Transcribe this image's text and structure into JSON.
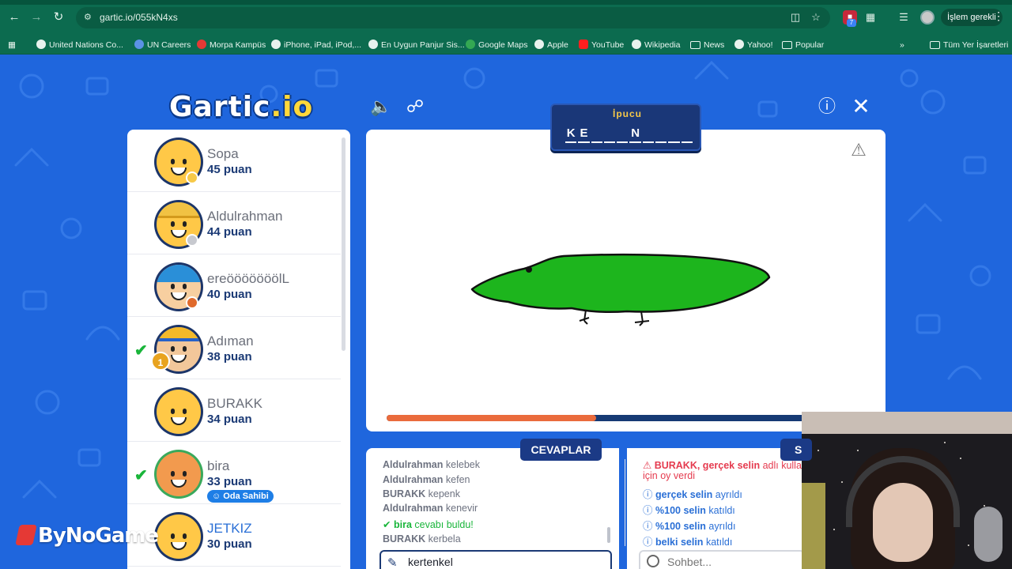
{
  "browser": {
    "url": "gartic.io/055kN4xs",
    "profile_button": "İşlem gerekli",
    "extension_badge": "7",
    "bookmarks": [
      {
        "label": "United Nations Co...",
        "icon": "un-icon"
      },
      {
        "label": "UN Careers",
        "icon": "un-icon"
      },
      {
        "label": "Morpa Kampüs",
        "icon": "morpa-icon"
      },
      {
        "label": "iPhone, iPad, iPod,...",
        "icon": "globe-icon"
      },
      {
        "label": "En Uygun Panjur Sis...",
        "icon": "globe-icon"
      },
      {
        "label": "Google Maps",
        "icon": "maps-icon"
      },
      {
        "label": "Apple",
        "icon": "globe-icon"
      },
      {
        "label": "YouTube",
        "icon": "youtube-icon"
      },
      {
        "label": "Wikipedia",
        "icon": "globe-icon"
      },
      {
        "label": "News",
        "icon": "folder-icon"
      },
      {
        "label": "Yahoo!",
        "icon": "globe-icon"
      },
      {
        "label": "Popular",
        "icon": "folder-icon"
      }
    ],
    "all_bookmarks": "Tüm Yer İşaretleri"
  },
  "game": {
    "logo_main": "Gartic",
    "logo_suffix": ".io",
    "hint_title": "İpucu",
    "hint_letters": [
      "K",
      "E",
      "",
      "",
      "",
      "N",
      "",
      "",
      "",
      "",
      ""
    ],
    "timer_progress": 0.49,
    "players": [
      {
        "name": "Sopa",
        "score": "45 puan",
        "status_color": "#f7c948",
        "hair": "none",
        "checked": false
      },
      {
        "name": "Aldulrahman",
        "score": "44 puan",
        "status_color": "#c7c9cf",
        "hair": "blonde",
        "checked": false
      },
      {
        "name": "ereööööööölL",
        "score": "40 puan",
        "status_color": "#e06a2c",
        "hair": "blue",
        "checked": false
      },
      {
        "name": "Adıman",
        "score": "38 puan",
        "status_color": "",
        "hair": "cap",
        "checked": true,
        "trophy": "1"
      },
      {
        "name": "BURAKK",
        "score": "34 puan",
        "status_color": "",
        "hair": "none",
        "checked": false
      },
      {
        "name": "bira",
        "score": "33 puan",
        "status_color": "",
        "hair": "none",
        "checked": true,
        "badge": "Oda Sahibi"
      },
      {
        "name": "JETKIZ",
        "score": "30 puan",
        "status_color": "",
        "hair": "none",
        "checked": false
      }
    ],
    "answers_tab": "CEVAPLAR",
    "chat_tab": "S",
    "answers": [
      {
        "who": "Aldulrahman",
        "text": "kelebek",
        "type": "normal"
      },
      {
        "who": "Aldulrahman",
        "text": "kefen",
        "type": "normal"
      },
      {
        "who": "BURAKK",
        "text": "kepenk",
        "type": "normal"
      },
      {
        "who": "Aldulrahman",
        "text": "kenevir",
        "type": "normal"
      },
      {
        "who": "bira",
        "text": "cevabı buldu!",
        "type": "success"
      },
      {
        "who": "BURAKK",
        "text": "kerbela",
        "type": "normal"
      }
    ],
    "chat": [
      {
        "who": "BURAKK, gerçek selin",
        "text": "adlı kulla",
        "type": "warn"
      },
      {
        "who": "",
        "text": "için oy verdi",
        "type": "warn"
      },
      {
        "who": "gerçek selin",
        "text": "ayrıldı",
        "type": "sys"
      },
      {
        "who": "%100 selin",
        "text": "katıldı",
        "type": "sys"
      },
      {
        "who": "%100 selin",
        "text": "ayrıldı",
        "type": "sys"
      },
      {
        "who": "belki selin",
        "text": "katıldı",
        "type": "sys"
      }
    ],
    "answer_input_value": "kertenkel",
    "chat_input_placeholder": "Sohbet..."
  },
  "overlay": {
    "watermark": "ByNoGame"
  },
  "colors": {
    "brand_blue": "#1f66dd",
    "panel_navy": "#1b3a75",
    "success": "#19b53a",
    "timer": "#ea6b3c",
    "drawing_green": "#1db51d"
  }
}
